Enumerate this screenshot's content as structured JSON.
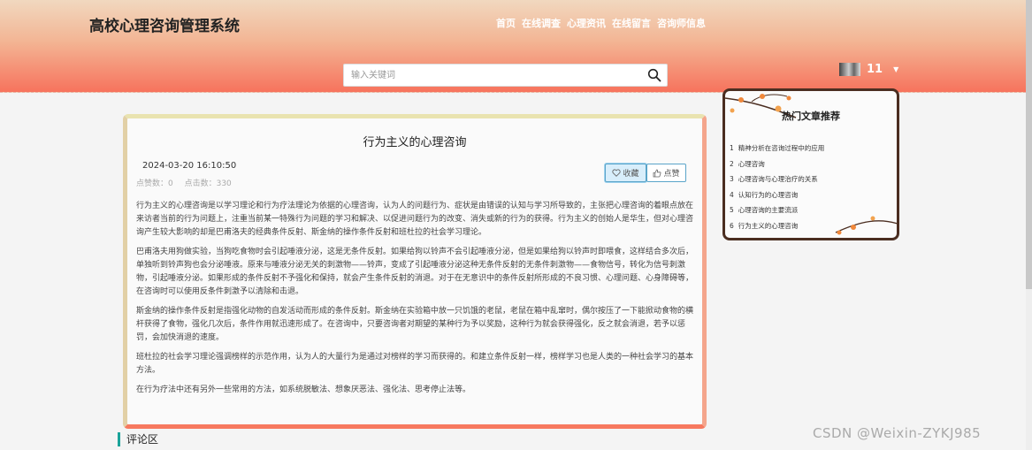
{
  "header": {
    "site_title": "高校心理咨询管理系统",
    "nav": [
      "首页",
      "在线调查",
      "心理资讯",
      "在线留言",
      "咨询师信息"
    ],
    "search_placeholder": "输入关键词",
    "username": "11"
  },
  "article": {
    "title": "行为主义的心理咨询",
    "time": "2024-03-20 16:10:50",
    "likes_label": "点赞数：0",
    "clicks_label": "点击数：330",
    "fav_button": "收藏",
    "like_button": "点赞",
    "paragraphs": [
      "行为主义的心理咨询是以学习理论和行为疗法理论为依据的心理咨询，认为人的问题行为、症状是由错误的认知与学习所导致的，主张把心理咨询的着眼点放在来访者当前的行为问题上，注重当前某一特殊行为问题的学习和解决、以促进问题行为的改变、消失或新的行为的获得。行为主义的创始人是华生，但对心理咨询产生较大影响的却是巴甫洛夫的经典条件反射、斯金纳的操作条件反射和班杜拉的社会学习理论。",
      "巴甫洛夫用狗做实验，当狗吃食物时会引起唾液分泌，这是无条件反射。如果给狗以铃声不会引起唾液分泌，但是如果给狗以铃声时即喂食，这样结合多次后，单独听到铃声狗也会分泌唾液。原来与唾液分泌无关的刺激物——铃声，变成了引起唾液分泌这种无条件反射的无条件刺激物——食物信号，转化为信号刺激物，引起唾液分泌。如果形成的条件反射不予强化和保持，就会产生条件反射的消退。对于在无意识中的条件反射所形成的不良习惯、心理问题、心身障碍等，在咨询时可以使用反条件刺激予以清除和击退。",
      "斯金纳的操作条件反射是指强化动物的自发活动而形成的条件反射。斯金纳在实验箱中放一只饥饿的老鼠，老鼠在箱中乱窜时，偶尔按压了一下能掀动食物的横杆获得了食物，强化几次后，条件作用就迅速形成了。在咨询中，只要咨询者对期望的某种行为予以奖励，这种行为就会获得强化，反之就会消退，若予以惩罚，会加快消退的速度。",
      "班杜拉的社会学习理论强调榜样的示范作用，认为人的大量行为是通过对榜样的学习而获得的。和建立条件反射一样，榜样学习也是人类的一种社会学习的基本方法。",
      "在行为疗法中还有另外一些常用的方法，如系统脱敏法、想象厌恶法、强化法、思考停止法等。"
    ]
  },
  "hot": {
    "title": "热门文章推荐",
    "items": [
      {
        "num": "1",
        "title": "精神分析在咨询过程中的应用"
      },
      {
        "num": "2",
        "title": "心理咨询"
      },
      {
        "num": "3",
        "title": "心理咨询与心理治疗的关系"
      },
      {
        "num": "4",
        "title": "认知行为的心理咨询"
      },
      {
        "num": "5",
        "title": "心理咨询的主要流派"
      },
      {
        "num": "6",
        "title": "行为主义的心理咨询"
      }
    ]
  },
  "comments": {
    "title": "评论区"
  },
  "watermark": "CSDN @Weixin-ZYKJ985",
  "colors": {
    "header_top": "#f1d8bf",
    "header_bottom": "#f7735d",
    "accent": "#1aa39a",
    "button_border": "#5aa4c9"
  }
}
